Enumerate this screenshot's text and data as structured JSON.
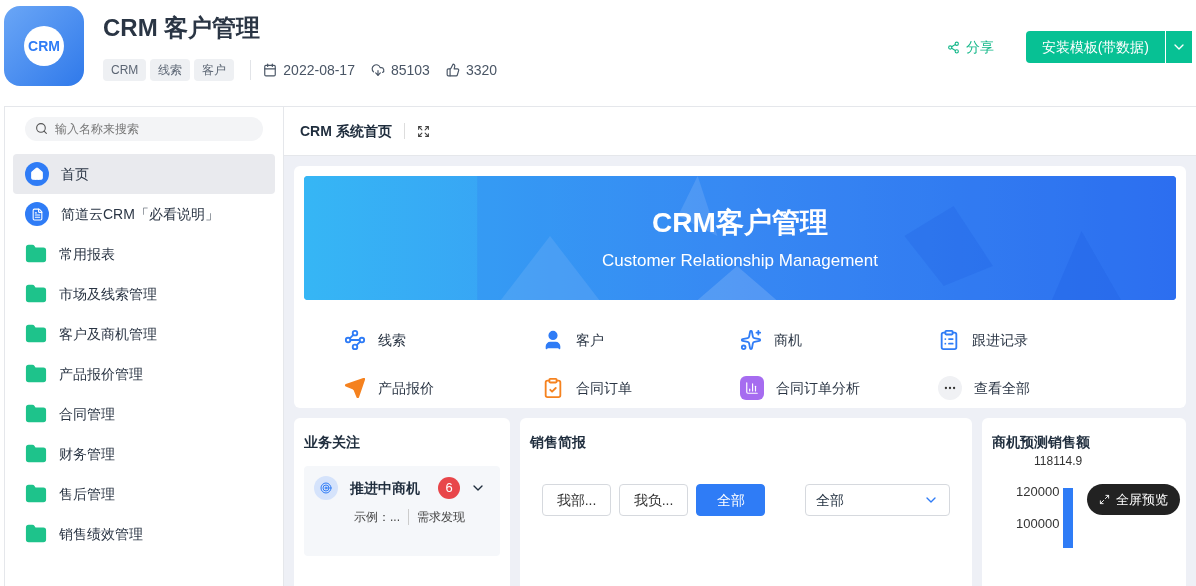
{
  "app": {
    "logo_text": "CRM",
    "title": "CRM 客户管理",
    "tags": [
      "CRM",
      "线索",
      "客户"
    ],
    "date": "2022-08-17",
    "downloads": "85103",
    "likes": "3320"
  },
  "actions": {
    "share": "分享",
    "install": "安装模板(带数据)"
  },
  "sidebar": {
    "search_placeholder": "输入名称来搜索",
    "items": [
      {
        "label": "首页",
        "kind": "home",
        "selected": true
      },
      {
        "label": "简道云CRM「必看说明」",
        "kind": "doc",
        "selected": false
      },
      {
        "label": "常用报表",
        "kind": "folder",
        "selected": false
      },
      {
        "label": "市场及线索管理",
        "kind": "folder",
        "selected": false
      },
      {
        "label": "客户及商机管理",
        "kind": "folder",
        "selected": false
      },
      {
        "label": "产品报价管理",
        "kind": "folder",
        "selected": false
      },
      {
        "label": "合同管理",
        "kind": "folder",
        "selected": false
      },
      {
        "label": "财务管理",
        "kind": "folder",
        "selected": false
      },
      {
        "label": "售后管理",
        "kind": "folder",
        "selected": false
      },
      {
        "label": "销售绩效管理",
        "kind": "folder",
        "selected": false
      }
    ]
  },
  "page": {
    "title": "CRM 系统首页",
    "banner": {
      "title": "CRM客户管理",
      "subtitle": "Customer Relationship Management"
    },
    "shortcuts": [
      "线索",
      "客户",
      "商机",
      "跟进记录",
      "产品报价",
      "合同订单",
      "合同订单分析",
      "查看全部"
    ],
    "focus": {
      "title": "业务关注",
      "item": {
        "label": "推进中商机",
        "count": "6",
        "example": "示例：...",
        "stage": "需求发现"
      }
    },
    "report": {
      "title": "销售简报",
      "filters": [
        {
          "label": "我部...",
          "selected": false
        },
        {
          "label": "我负...",
          "selected": false
        },
        {
          "label": "全部",
          "selected": true
        }
      ],
      "select_value": "全部"
    },
    "forecast": {
      "title": "商机预测销售额",
      "ticks": [
        "120000",
        "100000"
      ],
      "value_label": "118114.9",
      "fullscreen": "全屏预览"
    }
  }
}
